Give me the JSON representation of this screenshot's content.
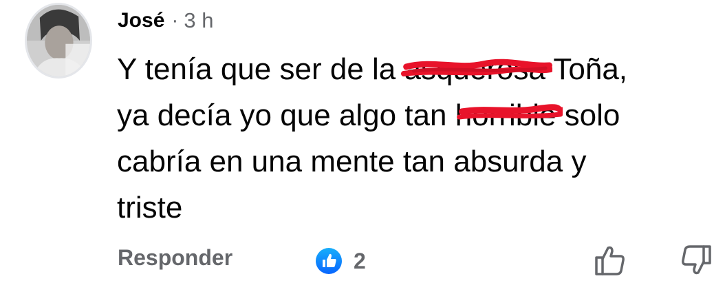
{
  "comment": {
    "author": "José",
    "separator": "·",
    "time": "3 h",
    "lines": [
      {
        "before": "Y tenía que ser de la ",
        "scribbled": "asquerosa",
        "after": " Toña,"
      },
      {
        "before": "ya decía yo que algo tan ",
        "scribbled": "horrible",
        "after": " solo"
      },
      {
        "text": "cabría en una mente tan absurda y"
      },
      {
        "text": "triste"
      }
    ]
  },
  "actions": {
    "reply_label": "Responder",
    "reaction_icon": "like-reaction-icon",
    "reaction_count": "2",
    "like_icon": "thumb-up-icon",
    "dislike_icon": "thumb-down-icon"
  },
  "colors": {
    "text": "#050505",
    "secondary": "#65676b",
    "like_blue": "#1877f2",
    "scribble_red": "#e8132a"
  }
}
